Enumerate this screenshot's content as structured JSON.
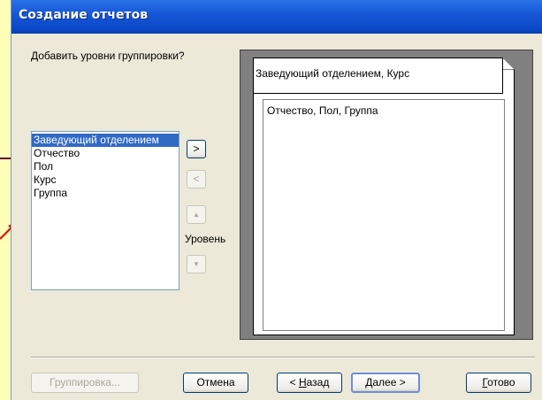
{
  "window": {
    "title": "Создание отчетов"
  },
  "prompt": "Добавить уровни группировки?",
  "fields_list": {
    "items": [
      {
        "label": "Заведующий отделением",
        "selected": true
      },
      {
        "label": "Отчество",
        "selected": false
      },
      {
        "label": "Пол",
        "selected": false
      },
      {
        "label": "Курс",
        "selected": false
      },
      {
        "label": "Группа",
        "selected": false
      }
    ]
  },
  "controls": {
    "add_label": ">",
    "remove_label": "<",
    "up_label": "▲",
    "down_label": "▼",
    "level_label": "Уровень"
  },
  "preview": {
    "group_header": "Заведующий отделением, Курс",
    "group_body": "Отчество, Пол, Группа"
  },
  "buttons": {
    "grouping": {
      "label": "Группировка...",
      "disabled": true
    },
    "cancel": {
      "label": "Отмена"
    },
    "back": {
      "prefix": "< ",
      "accel": "Н",
      "rest": "азад"
    },
    "next": {
      "accel": "Д",
      "rest": "алее >"
    },
    "finish": {
      "accel": "Г",
      "rest": "отово"
    }
  },
  "colors": {
    "background": "#FFFFB9",
    "titlebar": "#0A49C9",
    "selection": "#316AC5",
    "decoration_line": "#5A0E2E",
    "decoration_arrow": "#E00000"
  }
}
